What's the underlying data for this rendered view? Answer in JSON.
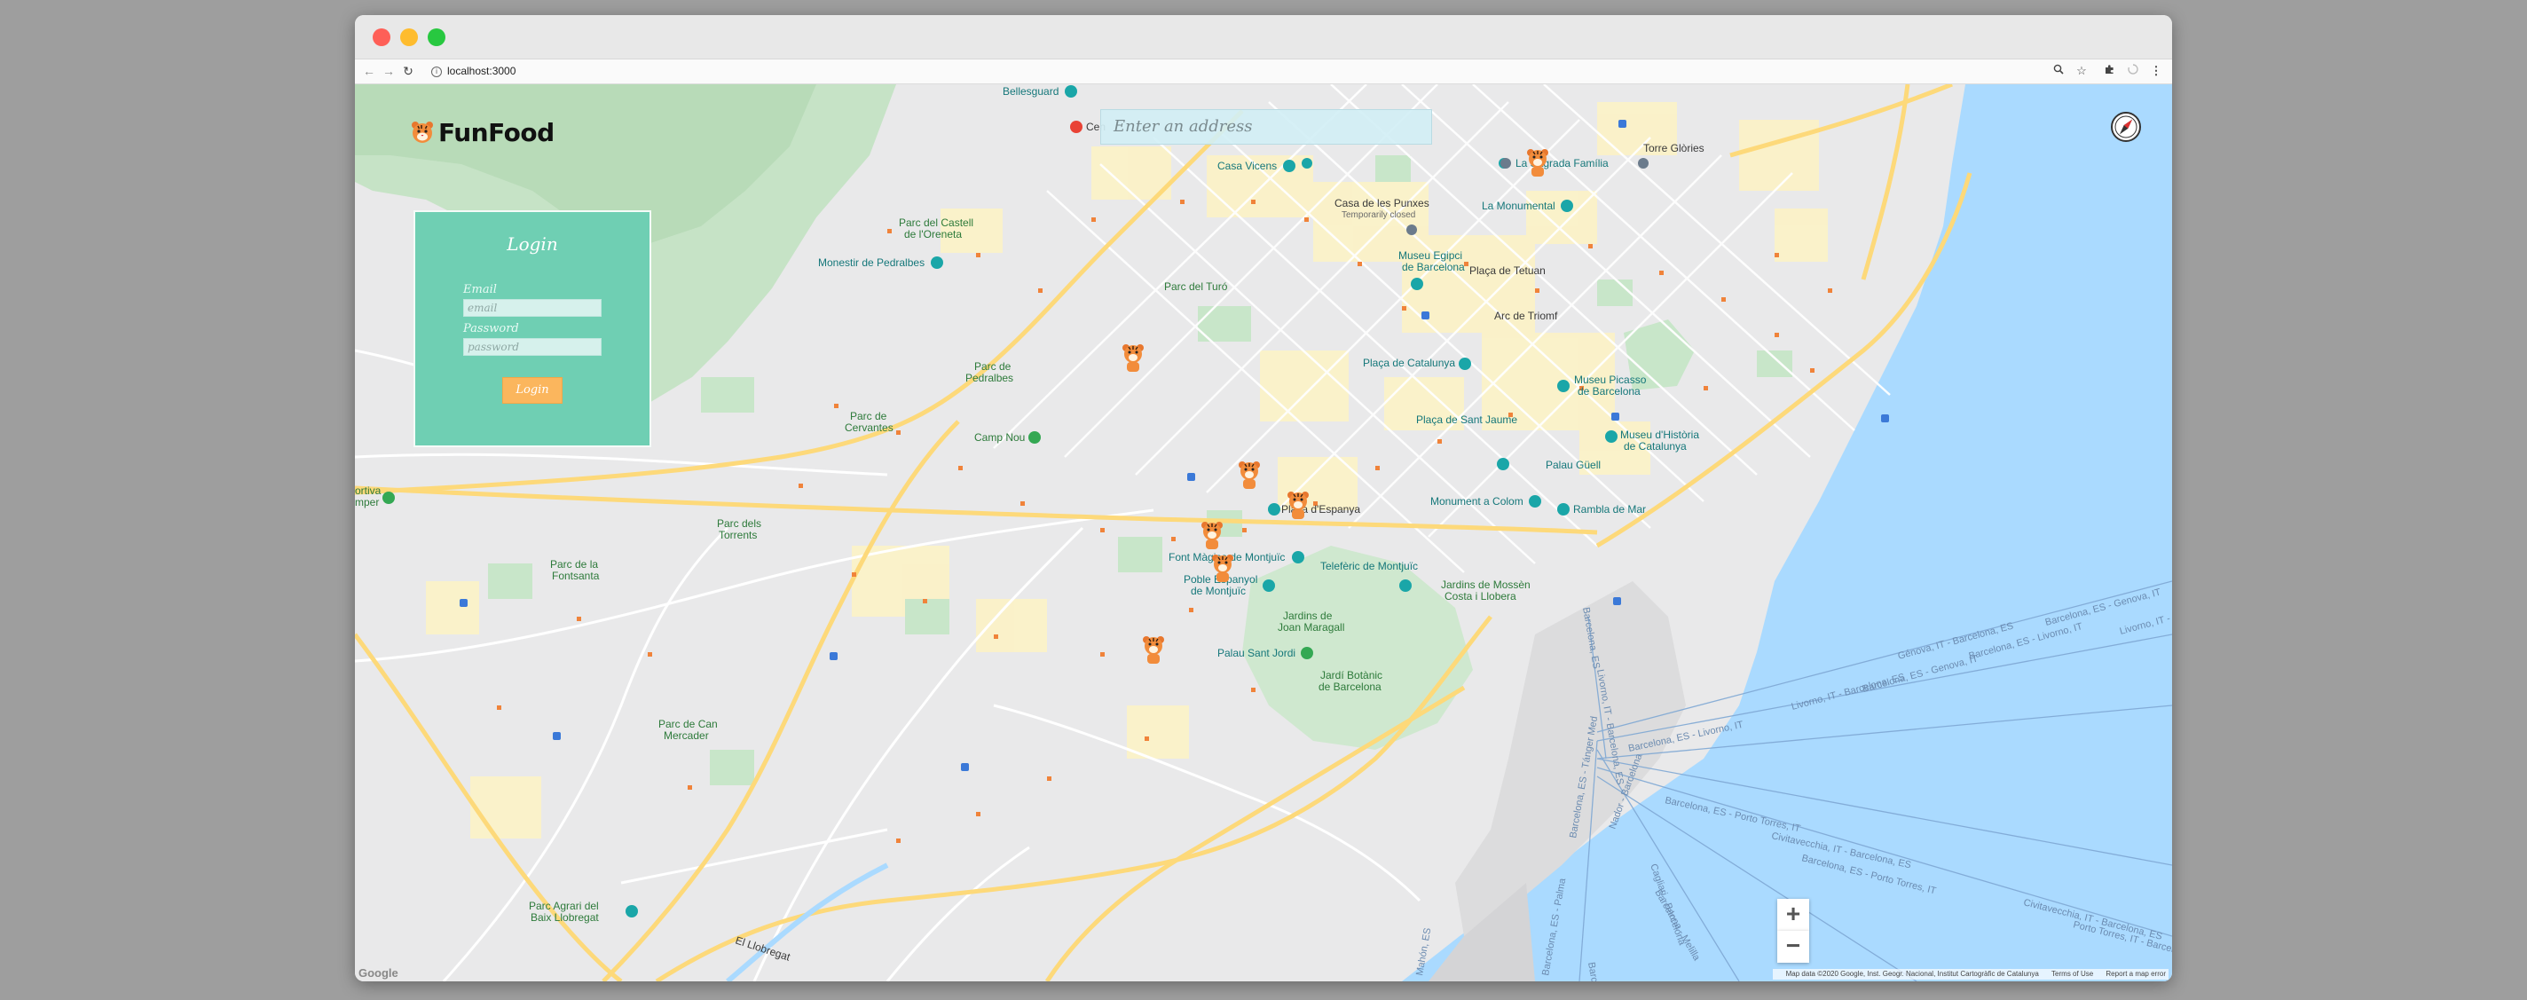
{
  "browser": {
    "url": "localhost:3000",
    "back_icon": "arrow-left-icon",
    "forward_icon": "arrow-right-icon",
    "reload_icon": "reload-icon",
    "info_icon": "info-icon",
    "zoom_icon": "magnifier-icon",
    "star_icon": "star-icon",
    "extensions_icon": "puzzle-icon",
    "loading_icon": "spinner-icon",
    "menu_icon": "kebab-menu-icon"
  },
  "app": {
    "logo_text": "FunFood",
    "search_placeholder": "Enter an address"
  },
  "login": {
    "title": "Login",
    "email_label": "Email",
    "email_placeholder": "email",
    "password_label": "Password",
    "password_placeholder": "password",
    "submit_label": "Login"
  },
  "map": {
    "zoom_in_label": "+",
    "zoom_out_label": "−",
    "google_mark": "Google",
    "attribution": "Map data ©2020 Google, Inst. Geogr. Nacional, Institut Cartogràfic de Catalunya",
    "terms": "Terms of Use",
    "report": "Report a map error",
    "labels": {
      "bellesguard": "Bellesguard",
      "hospital": "Cen",
      "casa_vicens": "Casa Vicens",
      "casa_punxes": "Casa de les Punxes",
      "temp_closed": "Temporarily closed",
      "sagrada": "La Sagrada Família",
      "torre_glories": "Torre Glòries",
      "monumental": "La Monumental",
      "parc_castell": "Parc del Castell",
      "oreneta": "de l'Oreneta",
      "pedralbes_mon": "Monestir de Pedralbes",
      "museu_egipci": "Museu Egipci",
      "de_barcelona": "de Barcelona",
      "placa_tetuan": "Plaça de Tetuan",
      "parc_turo": "Parc del Turó",
      "arc_triomf": "Arc de Triomf",
      "parc_pedralbes_1": "Parc de",
      "parc_pedralbes_2": "Pedralbes",
      "placa_catalunya": "Plaça de Catalunya",
      "museu_picasso_1": "Museu Picasso",
      "museu_picasso_2": "de Barcelona",
      "parc_cervantes_1": "Parc de",
      "parc_cervantes_2": "Cervantes",
      "camp_nou": "Camp Nou",
      "placa_jaume": "Plaça de Sant Jaume",
      "museu_historia_1": "Museu d'Història",
      "museu_historia_2": "de Catalunya",
      "palau_guell": "Palau Güell",
      "placa_espanya": "Plaça d'Espanya",
      "monument_colom": "Monument a Colom",
      "rambla_mar": "Rambla de Mar",
      "parc_torrents_1": "Parc dels",
      "parc_torrents_2": "Torrents",
      "font_magica": "Font Màgica de Montjuïc",
      "teleferic": "Telefèric de Montjuïc",
      "parc_fontsanta_1": "Parc de la",
      "parc_fontsanta_2": "Fontsanta",
      "poble_espanyol_1": "Poble Espanyol",
      "poble_espanyol_2": "de Montjuïc",
      "jardins_mossen_1": "Jardins de Mossèn",
      "jardins_mossen_2": "Costa i Llobera",
      "jardins_maragall_1": "Jardins de",
      "jardins_maragall_2": "Joan Maragall",
      "palau_jordi": "Palau Sant Jordi",
      "jardi_botanic_1": "Jardí Botànic",
      "jardi_botanic_2": "de Barcelona",
      "parc_can_mercader_1": "Parc de Can",
      "parc_can_mercader_2": "Mercader",
      "parc_agrari_1": "Parc Agrari del",
      "parc_agrari_2": "Baix Llobregat",
      "llobregat": "El Llobregat",
      "portiva_1": "ortiva",
      "portiva_2": "mper",
      "route_1": "Barcelona, ES - Genova, IT",
      "route_2": "Génova, IT - Barcelona, ES",
      "route_3": "Barcelona, ES - Livorno, IT",
      "route_4": "Livorno, IT - Barcelona, ES",
      "route_5": "Barcelona, ES - Livorno, IT",
      "route_6": "Barcelona, ES - Porto Torres, IT",
      "route_7": "Civitavecchia, IT - Barcelona, ES",
      "route_8": "Barcelona, ES - Porto Torres, IT",
      "route_9": "Civitavecchia, IT - Barcelona, ES",
      "route_10": "Porto Torres, IT - Barcelona, ES",
      "route_11": "Barcelona, ES - Genova, IT",
      "route_12": "Livorno, IT -",
      "route_13": "Barcelona, ES - Tánger Med",
      "route_14": "Livorno, IT - Barcelona, ES",
      "route_15": "Barcelona, ES",
      "route_16": "Nador - Barcelona",
      "route_17": "Barcelona - Melilla",
      "route_18": "Cagliari - Barcelona",
      "route_19": "Barcelona, ES - Palma",
      "route_20": "Barcelona - Ibiza",
      "route_21": "Mahón, ES"
    }
  },
  "colors": {
    "sea": "#aadaff",
    "land": "#e9e9e9",
    "park": "#c8e6c9",
    "urban_yellow": "#fdf3c4",
    "highway": "#fdd97a",
    "login_panel": "#6fcfb3",
    "login_button": "#fbb65d"
  }
}
